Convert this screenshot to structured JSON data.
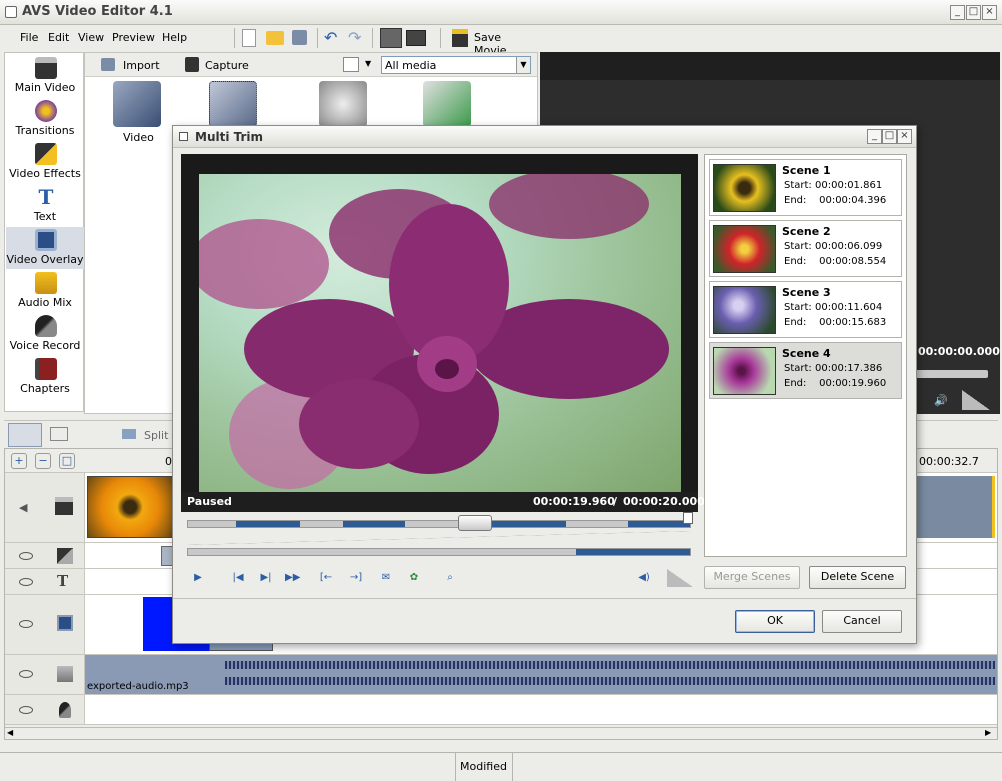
{
  "window": {
    "title": "AVS Video Editor 4.1"
  },
  "menu": [
    "File",
    "Edit",
    "View",
    "Preview",
    "Help"
  ],
  "toolbar": {
    "save_movie": "Save Movie..."
  },
  "sidebar": {
    "items": [
      {
        "label": "Main Video",
        "icon": "film-clapper-icon"
      },
      {
        "label": "Transitions",
        "icon": "transitions-icon"
      },
      {
        "label": "Video Effects",
        "icon": "video-effects-icon"
      },
      {
        "label": "Text",
        "icon": "text-t-icon"
      },
      {
        "label": "Video Overlay",
        "icon": "video-overlay-icon"
      },
      {
        "label": "Audio Mix",
        "icon": "audio-mix-icon"
      },
      {
        "label": "Voice Record",
        "icon": "microphone-icon"
      },
      {
        "label": "Chapters",
        "icon": "chapters-icon"
      }
    ]
  },
  "media": {
    "import_label": "Import",
    "capture_label": "Capture",
    "filter_value": "All media",
    "items": [
      {
        "label": "Video"
      }
    ]
  },
  "preview": {
    "time": "00:00:00.000"
  },
  "timeline": {
    "split_label": "Split",
    "ruler_start": "0",
    "ruler_end": "00:00:32.7",
    "audio_clip_label": "exported-audio.mp3"
  },
  "status": {
    "text": "Modified"
  },
  "dialog": {
    "title": "Multi Trim",
    "status": "Paused",
    "current_time": "00:00:19.960",
    "time_separator": "/",
    "total_time": "00:00:20.000",
    "scenes": [
      {
        "name": "Scene 1",
        "start_label": "Start:",
        "start": "00:00:01.861",
        "end_label": "End:",
        "end": "00:00:04.396",
        "thumb_color": "#e8c020"
      },
      {
        "name": "Scene 2",
        "start_label": "Start:",
        "start": "00:00:06.099",
        "end_label": "End:",
        "end": "00:00:08.554",
        "thumb_color": "#d0242a"
      },
      {
        "name": "Scene 3",
        "start_label": "Start:",
        "start": "00:00:11.604",
        "end_label": "End:",
        "end": "00:00:15.683",
        "thumb_color": "#6a5eb0"
      },
      {
        "name": "Scene 4",
        "start_label": "Start:",
        "start": "00:00:17.386",
        "end_label": "End:",
        "end": "00:00:19.960",
        "thumb_color": "#a8389a"
      }
    ],
    "merge_label": "Merge Scenes",
    "delete_label": "Delete Scene",
    "ok_label": "OK",
    "cancel_label": "Cancel"
  }
}
